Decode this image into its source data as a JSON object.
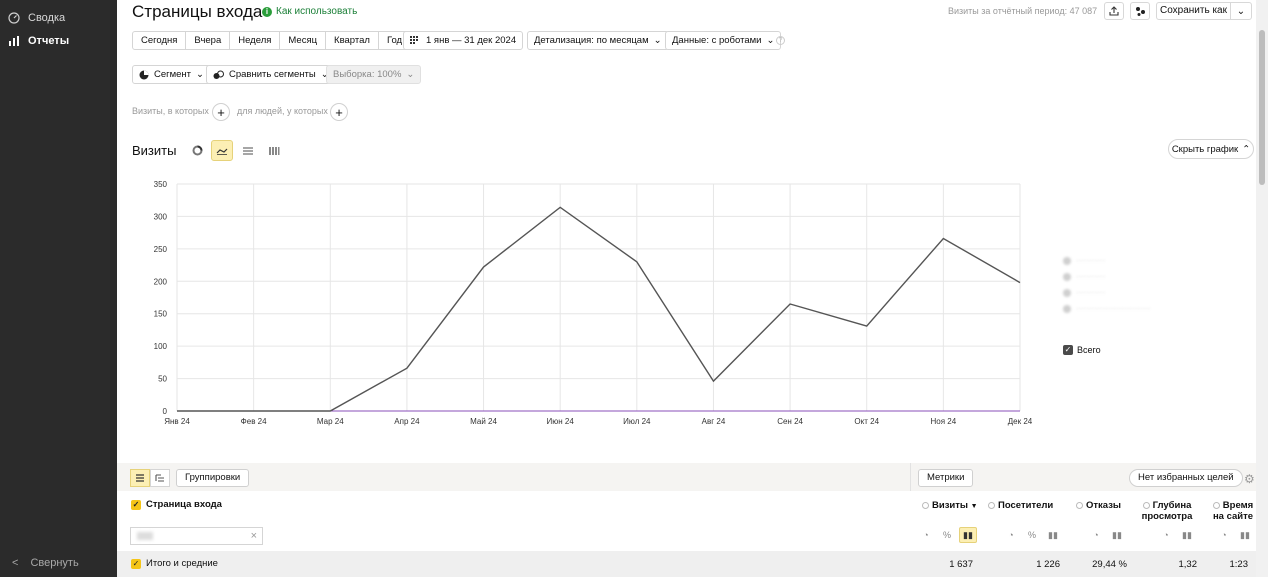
{
  "sidebar": {
    "items": [
      {
        "label": "Сводка",
        "icon": "gauge-icon",
        "active": false
      },
      {
        "label": "Отчеты",
        "icon": "bar-chart-icon",
        "active": true
      }
    ],
    "collapse_label": "Свернуть"
  },
  "header": {
    "title": "Страницы входа",
    "howto_label": "Как использовать",
    "period_text": "Визиты за отчётный период: 47 087",
    "save_label": "Сохранить как"
  },
  "periods": [
    "Сегодня",
    "Вчера",
    "Неделя",
    "Месяц",
    "Квартал",
    "Год"
  ],
  "date_range": "1 янв — 31 дек 2024",
  "detail_label": "Детализация: по месяцам",
  "data_label": "Данные: с роботами",
  "segment_label": "Сегмент",
  "compare_label": "Сравнить сегменты",
  "sample_label": "Выборка: 100%",
  "conditions": {
    "visits_label": "Визиты, в которых",
    "people_label": "для людей, у которых"
  },
  "chart_header": {
    "title": "Визиты",
    "hide_label": "Скрыть график"
  },
  "chart_data": {
    "type": "line",
    "categories": [
      "Янв 24",
      "Фев 24",
      "Мар 24",
      "Апр 24",
      "Май 24",
      "Июн 24",
      "Июл 24",
      "Авг 24",
      "Сен 24",
      "Окт 24",
      "Ноя 24",
      "Дек 24"
    ],
    "series": [
      {
        "name": "Всего",
        "values": [
          0,
          0,
          0,
          66,
          222,
          314,
          230,
          46,
          165,
          131,
          266,
          198
        ],
        "color": "#555555"
      }
    ],
    "ylim": [
      0,
      350
    ],
    "yticks": [
      0,
      50,
      100,
      150,
      200,
      250,
      300,
      350
    ],
    "xlabel": "",
    "ylabel": "",
    "grid": true
  },
  "legend": {
    "all_label": "Всего"
  },
  "table": {
    "groupings_label": "Группировки",
    "metrics_label": "Метрики",
    "goals_label": "Нет избранных целей",
    "dimension_label": "Страница входа",
    "columns": [
      "Визиты",
      "Посетители",
      "Отказы",
      "Глубина просмотра",
      "Время на сайте"
    ],
    "sort_marker": "▼",
    "total_label": "Итого и средние",
    "totals": [
      "1 637",
      "1 226",
      "29,44 %",
      "1,32",
      "1:23"
    ]
  }
}
